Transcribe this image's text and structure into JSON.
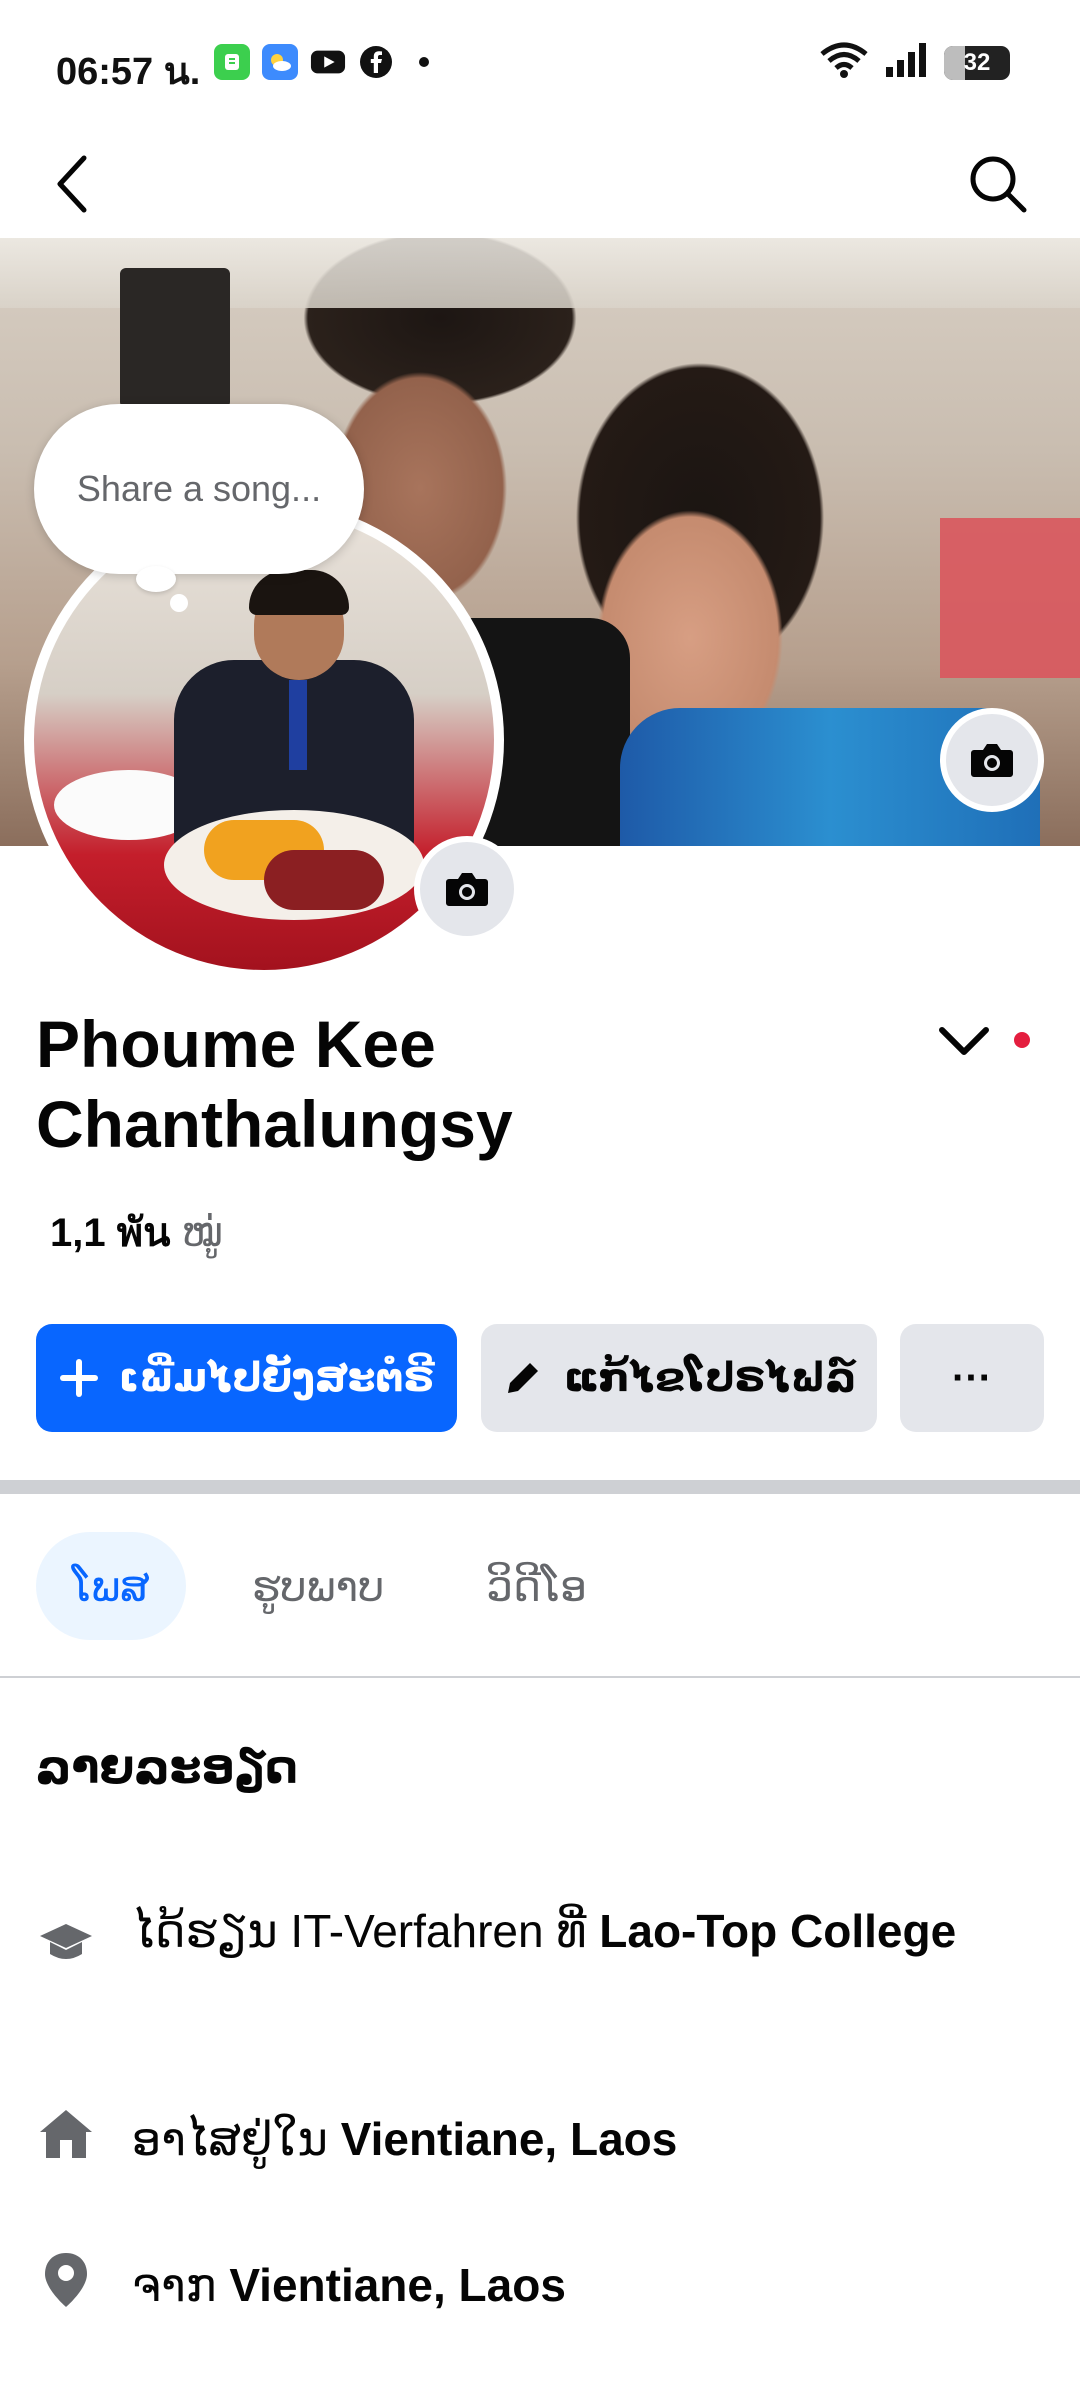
{
  "status_bar": {
    "time": "06:57 น.",
    "battery": "32",
    "battery_level": 0.32,
    "app_icons": [
      "messages-app-icon",
      "weather-app-icon",
      "youtube-icon",
      "facebook-icon",
      "more-dot-icon"
    ]
  },
  "top_bar": {
    "back_icon": "back-arrow-icon",
    "search_icon": "search-icon"
  },
  "profile": {
    "song_prompt": "Share a song...",
    "name": "Phoume Kee Chanthalungsy",
    "friends_count": "1,1 พัน",
    "friends_label": "ໝູ່"
  },
  "actions": {
    "add_story": "ເພີ່ມໄປຍັງສະຕໍຣີ",
    "edit_profile": "ແກ້ໄຂໂປຣໄຟລ໌",
    "more": "···"
  },
  "tabs": [
    {
      "label": "ໂພສ",
      "active": true
    },
    {
      "label": "ຮູບພາບ",
      "active": false
    },
    {
      "label": "ວິດີໂອ",
      "active": false
    }
  ],
  "details": {
    "title": "ລາຍລະອຽດ",
    "education_prefix": "ໄດ້ຮຽນ IT-Verfahren ທີ່",
    "education_school": "Lao-Top College",
    "lives_prefix": "ອາໄສຢູ່ໃນ",
    "lives_place": "Vientiane, Laos",
    "from_prefix": "ຈາກ",
    "from_place": "Vientiane, Laos"
  },
  "colors": {
    "primary": "#0866ff",
    "secondary_button": "#e4e6eb",
    "notification": "#e41e3f",
    "muted_text": "#65676b"
  }
}
